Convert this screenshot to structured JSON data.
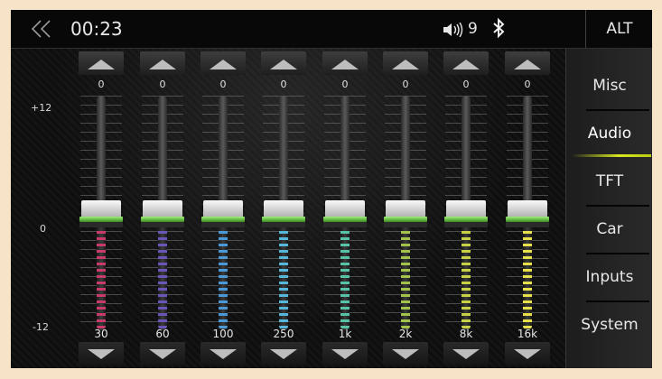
{
  "status_bar": {
    "time": "00:23",
    "volume": "9",
    "alt_label": "ALT",
    "icons": [
      "back-chevron-icon",
      "volume-icon",
      "bluetooth-icon"
    ]
  },
  "eq": {
    "scale": {
      "max": "+12",
      "zero": "0",
      "min": "-12"
    },
    "bands": [
      {
        "freq": "30",
        "value": "0",
        "color": "#c83a6a"
      },
      {
        "freq": "60",
        "value": "0",
        "color": "#6a56b8"
      },
      {
        "freq": "100",
        "value": "0",
        "color": "#4a98d6"
      },
      {
        "freq": "250",
        "value": "0",
        "color": "#55b8d8"
      },
      {
        "freq": "1k",
        "value": "0",
        "color": "#56c2a8"
      },
      {
        "freq": "2k",
        "value": "0",
        "color": "#a2c24a"
      },
      {
        "freq": "8k",
        "value": "0",
        "color": "#c8d046"
      },
      {
        "freq": "16k",
        "value": "0",
        "color": "#e8e04a"
      }
    ]
  },
  "menu": {
    "items": [
      {
        "label": "Misc"
      },
      {
        "label": "Audio",
        "active": true
      },
      {
        "label": "TFT"
      },
      {
        "label": "Car"
      },
      {
        "label": "Inputs"
      },
      {
        "label": "System"
      }
    ]
  },
  "colors": {
    "active_accent": "#d8e820",
    "knob_glow": "#6ccf3a"
  }
}
